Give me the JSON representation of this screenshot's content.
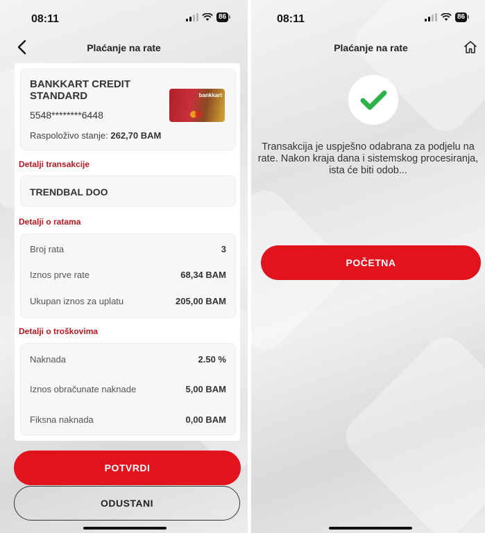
{
  "left": {
    "status": {
      "time": "08:11",
      "battery": "86"
    },
    "nav": {
      "title": "Plaćanje na rate",
      "back_icon": "chevron-left-icon"
    },
    "card": {
      "name": "BANKKART CREDIT STANDARD",
      "number": "5548********6448",
      "balance_label": "Raspoloživo stanje:",
      "balance_value": "262,70 BAM",
      "image_brand": "bankkart"
    },
    "transaction": {
      "section_label": "Detalji transakcije",
      "merchant": "TRENDBAL DOO"
    },
    "installments": {
      "section_label": "Detalji o ratama",
      "rows": [
        {
          "label": "Broj rata",
          "value": "3"
        },
        {
          "label": "Iznos prve rate",
          "value": "68,34 BAM"
        },
        {
          "label": "Ukupan iznos za uplatu",
          "value": "205,00 BAM"
        }
      ]
    },
    "costs": {
      "section_label": "Detalji o troškovima",
      "rows": [
        {
          "label": "Naknada",
          "value": "2.50 %"
        },
        {
          "label": "Iznos obračunate naknade",
          "value": "5,00 BAM"
        },
        {
          "label": "Fiksna naknada",
          "value": "0,00 BAM"
        }
      ]
    },
    "buttons": {
      "confirm": "POTVRDI",
      "cancel": "ODUSTANI"
    }
  },
  "right": {
    "status": {
      "time": "08:11",
      "battery": "86"
    },
    "nav": {
      "title": "Plaćanje na rate",
      "home_icon": "home-icon"
    },
    "success_icon": "checkmark-icon",
    "message": "Transakcija je uspješno odabrana za podjelu na rate. Nakon kraja dana i sistemskog procesiranja, ista će biti odob...",
    "button": "POČETNA"
  },
  "colors": {
    "accent": "#e0131f",
    "section_label": "#c0161f",
    "success": "#2db34a"
  }
}
